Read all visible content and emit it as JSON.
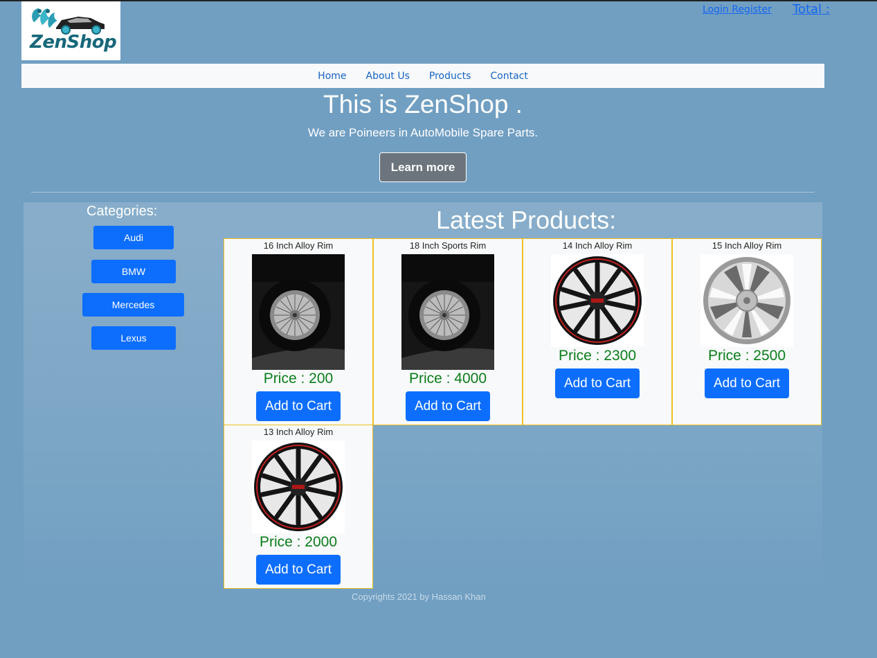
{
  "brand": {
    "logo_text": "ZenShop"
  },
  "header": {
    "login_label": "Login Register",
    "total_label": "Total :"
  },
  "nav": {
    "items": [
      "Home",
      "About Us",
      "Products",
      "Contact"
    ]
  },
  "hero": {
    "title": "This is ZenShop .",
    "subtitle": "We are Poineers in AutoMobile Spare Parts.",
    "button_label": "Learn more"
  },
  "categories": {
    "title": "Categories:",
    "items": [
      "Audi",
      "BMW",
      "Mercedes",
      "Lexus"
    ]
  },
  "products": {
    "title": "Latest Products:",
    "items": [
      {
        "name": "16 Inch Alloy Rim",
        "price": "Price : 200",
        "button": "Add to Cart",
        "image": "tire-photo"
      },
      {
        "name": "18 Inch Sports Rim",
        "price": "Price : 4000",
        "button": "Add to Cart",
        "image": "tire-photo"
      },
      {
        "name": "14 Inch Alloy Rim",
        "price": "Price : 2300",
        "button": "Add to Cart",
        "image": "black-rim"
      },
      {
        "name": "15 Inch Alloy Rim",
        "price": "Price : 2500",
        "button": "Add to Cart",
        "image": "silver-rim"
      },
      {
        "name": "13 Inch Alloy Rim",
        "price": "Price : 2000",
        "button": "Add to Cart",
        "image": "black-rim"
      }
    ]
  },
  "footer": {
    "text": "Copyrights 2021 by Hassan Khan"
  },
  "colors": {
    "background": "#719fc2",
    "primary": "#0d6efd",
    "price": "#0a7d1a",
    "card_border": "#f0c020",
    "logo_teal": "#17677a"
  }
}
